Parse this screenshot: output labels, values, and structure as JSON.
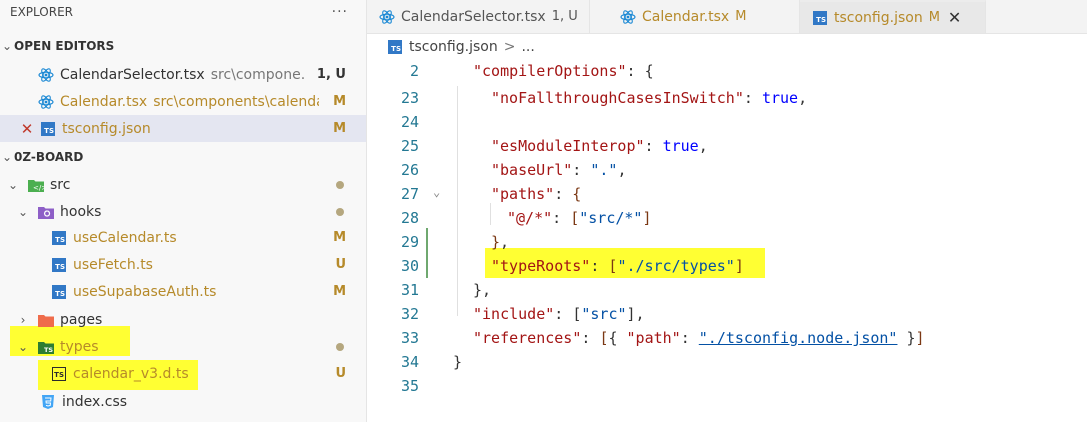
{
  "explorer": {
    "title": "EXPLORER",
    "more": "···",
    "open_editors_title": "OPEN EDITORS",
    "open_editors": [
      {
        "name": "CalendarSelector.tsx",
        "path": "src\\compone...",
        "status": "1, U"
      },
      {
        "name": "Calendar.tsx",
        "path": "src\\components\\calendar",
        "status": "M"
      },
      {
        "name": "tsconfig.json",
        "status": "M"
      }
    ],
    "project_title": "0Z-BOARD",
    "tree": {
      "src": "src",
      "hooks": "hooks",
      "useCalendar": "useCalendar.ts",
      "useCalendar_status": "M",
      "useFetch": "useFetch.ts",
      "useFetch_status": "U",
      "useSupabaseAuth": "useSupabaseAuth.ts",
      "useSupabaseAuth_status": "M",
      "pages": "pages",
      "types": "types",
      "calendar_v3": "calendar_v3.d.ts",
      "calendar_v3_status": "U",
      "index_css": "index.css"
    }
  },
  "tabs": [
    {
      "name": "CalendarSelector.tsx",
      "status": "1, U"
    },
    {
      "name": "Calendar.tsx",
      "status": "M"
    },
    {
      "name": "tsconfig.json",
      "status": "M"
    }
  ],
  "breadcrumb": {
    "file": "tsconfig.json",
    "sep": ">",
    "rest": "..."
  },
  "code": {
    "line_numbers": [
      "2",
      "23",
      "24",
      "25",
      "26",
      "27",
      "28",
      "29",
      "30",
      "31",
      "32",
      "33",
      "34",
      "35"
    ],
    "compilerOptions_key": "\"compilerOptions\"",
    "noFallthrough_key": "\"noFallthroughCasesInSwitch\"",
    "true1": "true",
    "esModuleInterop_key": "\"esModuleInterop\"",
    "true2": "true",
    "baseUrl_key": "\"baseUrl\"",
    "baseUrl_val": "\".\"",
    "paths_key": "\"paths\"",
    "alias_key": "\"@/*\"",
    "alias_val": "\"src/*\"",
    "typeRoots_key": "\"typeRoots\"",
    "typeRoots_val": "\"./src/types\"",
    "include_key": "\"include\"",
    "include_val": "\"src\"",
    "references_key": "\"references\"",
    "path_key": "\"path\"",
    "path_val": "\"./tsconfig.node.json\""
  },
  "colors": {
    "highlight": "#ffff33",
    "modified": "#b68a2a",
    "accent": "#3178c6"
  }
}
